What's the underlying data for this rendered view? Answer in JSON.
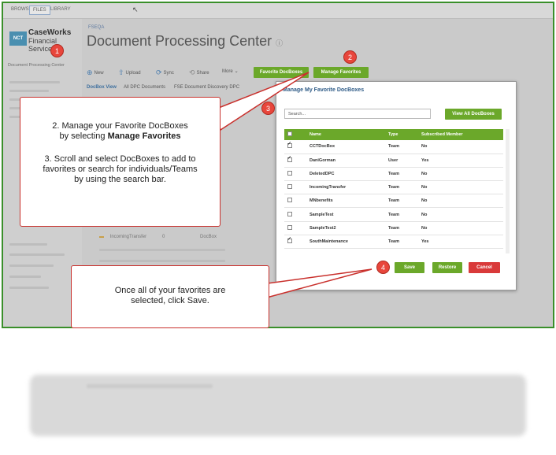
{
  "top_tabs": [
    "BROWSE",
    "FILES",
    "LIBRARY"
  ],
  "logo": {
    "badge": "NCT",
    "name": "CaseWorks",
    "sub": "Financial Services"
  },
  "sidebar": {
    "active_item": "Document Processing Center"
  },
  "breadcrumb": "FSEQA",
  "page_title": "Document Processing Center",
  "toolbar": {
    "new": "New",
    "upload": "Upload",
    "sync": "Sync",
    "share": "Share",
    "more": "More"
  },
  "buttons": {
    "favorite_docboxes": "Favorite DocBoxes",
    "manage_favorites": "Manage Favorites"
  },
  "views": [
    "DocBox View",
    "All DPC Documents",
    "FSE Document Discovery DPC"
  ],
  "background_rows": [
    {
      "name": "IncomingTransfer",
      "count": "0",
      "type": "DocBox"
    }
  ],
  "modal": {
    "title": "Manage My Favorite DocBoxes",
    "search_placeholder": "Search...",
    "view_all_label": "View All DocBoxes",
    "columns": [
      "Name",
      "Type",
      "Subscribed Member"
    ],
    "rows": [
      {
        "checked": true,
        "name": "CCTDocBox",
        "type": "Team",
        "member": "No"
      },
      {
        "checked": true,
        "name": "DaniGorman",
        "type": "User",
        "member": "Yes"
      },
      {
        "checked": false,
        "name": "DeletedDPC",
        "type": "Team",
        "member": "No"
      },
      {
        "checked": false,
        "name": "IncomingTransfer",
        "type": "Team",
        "member": "No"
      },
      {
        "checked": false,
        "name": "MNbenefits",
        "type": "Team",
        "member": "No"
      },
      {
        "checked": false,
        "name": "SampleTest",
        "type": "Team",
        "member": "No"
      },
      {
        "checked": false,
        "name": "SampleTest2",
        "type": "Team",
        "member": "No"
      },
      {
        "checked": true,
        "name": "SouthMaintenance",
        "type": "Team",
        "member": "Yes"
      }
    ],
    "save": "Save",
    "restore": "Restore",
    "cancel": "Cancel"
  },
  "callouts": {
    "step2_line1": "2. Manage your Favorite DocBoxes",
    "step2_line2a": "by selecting ",
    "step2_line2b": "Manage Favorites",
    "step3": "3. Scroll and select DocBoxes to add to favorites or search for individuals/Teams by using the search bar.",
    "step4": "Once all of your favorites are selected, click Save."
  },
  "badges": [
    "1",
    "2",
    "3",
    "4"
  ]
}
